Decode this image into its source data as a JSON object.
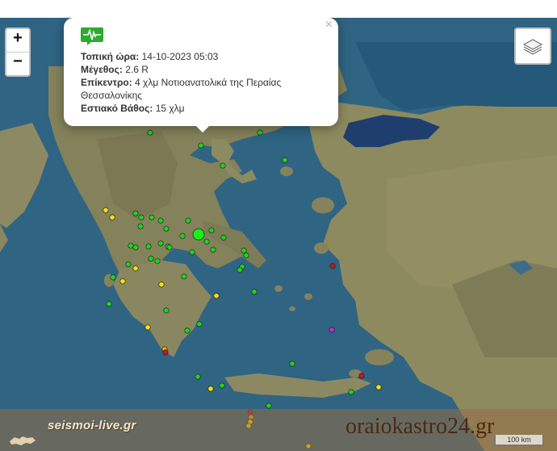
{
  "popup": {
    "time_label": "Τοπική ώρα:",
    "time_value": "14-10-2023 05:03",
    "magnitude_label": "Μέγεθος:",
    "magnitude_value": "2.6 R",
    "epicenter_label": "Επίκεντρο:",
    "epicenter_value": "4 χλμ Νοτιοανατολικά της Περαίας Θεσσαλονίκης",
    "depth_label": "Εστιακό Βάθος:",
    "depth_value": "15 χλμ",
    "close_glyph": "×",
    "icon": "seismograph-icon"
  },
  "controls": {
    "zoom_in": "+",
    "zoom_out": "−",
    "layers_icon": "layers-icon"
  },
  "footer": {
    "left_brand": "seismoi-live.gr",
    "right_brand": "oraiokastro24.gr",
    "scale_label": "100 km"
  },
  "colors": {
    "green": "#22d11e",
    "yellow": "#f5e10c",
    "orange": "#f5a20c",
    "red": "#d0141b",
    "magenta": "#c42ad0",
    "highlight": "#1aef1a"
  }
}
